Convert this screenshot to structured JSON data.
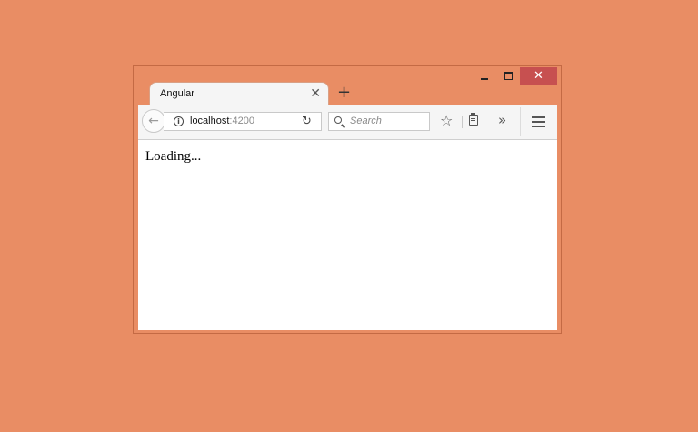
{
  "window": {
    "controls": {
      "minimize_icon": "minimize-icon",
      "maximize_icon": "maximize-icon",
      "close_label": "✕"
    }
  },
  "tabs": [
    {
      "title": "Angular",
      "close_label": "✕"
    }
  ],
  "new_tab_label": "+",
  "navbar": {
    "back_icon": "←",
    "url_host": "localhost",
    "url_port": ":4200",
    "info_icon": "i",
    "reload_icon": "↻",
    "search_placeholder": "Search",
    "star_icon": "☆",
    "overflow_icon": "»"
  },
  "page": {
    "content_text": "Loading..."
  },
  "colors": {
    "desktop_background": "#e98d64",
    "close_button": "#c75050",
    "toolbar": "#f5f5f5"
  }
}
